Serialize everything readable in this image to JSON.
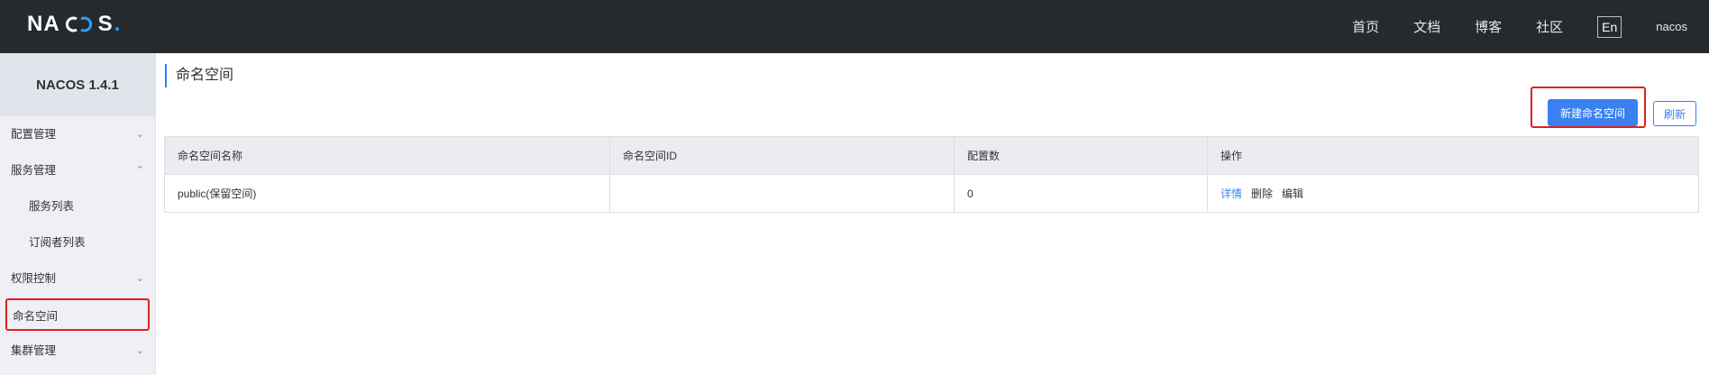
{
  "header": {
    "logo_text": "NACOS",
    "nav": [
      "首页",
      "文档",
      "博客",
      "社区"
    ],
    "lang": "En",
    "user": "nacos"
  },
  "sidebar": {
    "version": "NACOS 1.4.1",
    "items": [
      {
        "label": "配置管理",
        "chevron": "down"
      },
      {
        "label": "服务管理",
        "chevron": "up"
      },
      {
        "label": "服务列表",
        "chevron": ""
      },
      {
        "label": "订阅者列表",
        "chevron": ""
      },
      {
        "label": "权限控制",
        "chevron": "down"
      },
      {
        "label": "命名空间",
        "chevron": ""
      },
      {
        "label": "集群管理",
        "chevron": "down"
      }
    ]
  },
  "main": {
    "title": "命名空间",
    "create_button": "新建命名空间",
    "refresh_button": "刷新",
    "table": {
      "headers": [
        "命名空间名称",
        "命名空间ID",
        "配置数",
        "操作"
      ],
      "rows": [
        {
          "name": "public(保留空间)",
          "id": "",
          "count": "0",
          "ops": [
            "详情",
            "删除",
            "编辑"
          ]
        }
      ]
    }
  },
  "colors": {
    "topbar": "#252a2f",
    "accent": "#3a81f0",
    "highlight": "#e02020"
  }
}
